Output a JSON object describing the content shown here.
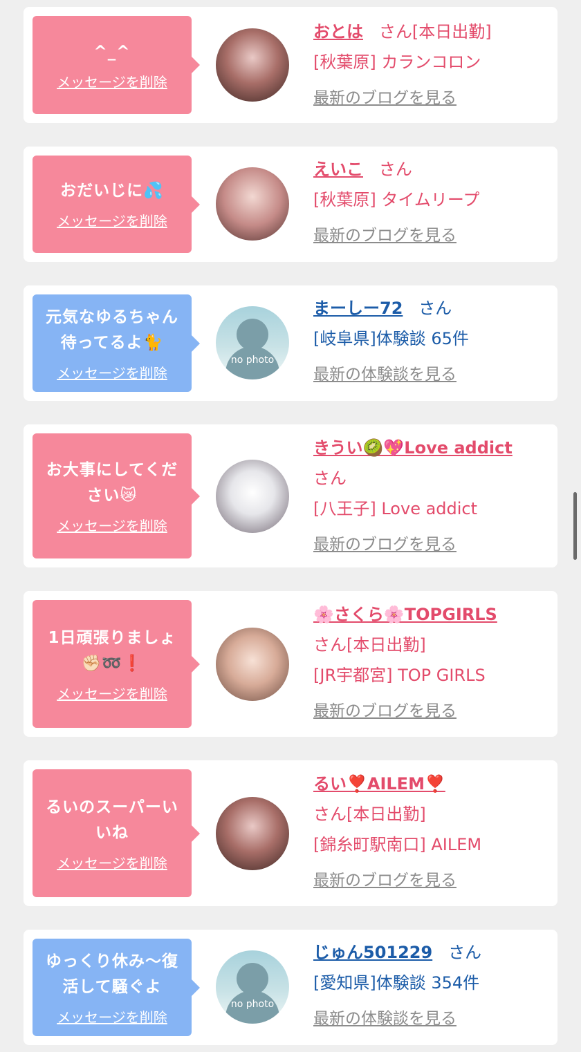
{
  "delete_label": "メッセージを削除",
  "cards": [
    {
      "type": "girl",
      "bubble_color": "pink",
      "message": "^_^",
      "name": "おとは",
      "suffix": "さん[本日出勤]",
      "area": "[秋葉原] カランコロン",
      "link": "最新のブログを見る",
      "avatar": "photo"
    },
    {
      "type": "girl",
      "bubble_color": "pink",
      "message": "おだいじに💦",
      "name": "えいこ",
      "suffix": "さん",
      "area": "[秋葉原] タイムリープ",
      "link": "最新のブログを見る",
      "avatar": "photo"
    },
    {
      "type": "user",
      "bubble_color": "blue",
      "message": "元気なゆるちゃん待ってるよ🐈",
      "name": "まーしー72",
      "suffix": "さん",
      "area": "[岐阜県]体験談 65件",
      "link": "最新の体験談を見る",
      "avatar": "no photo"
    },
    {
      "type": "girl",
      "bubble_color": "pink",
      "message": "お大事にしてください😿",
      "name": "きうい🥝💖Love addict",
      "suffix": "さん",
      "area": "[八王子] Love addict",
      "link": "最新のブログを見る",
      "avatar": "photo"
    },
    {
      "type": "girl",
      "bubble_color": "pink",
      "message": "1日頑張りましょ✊🏻➿❗",
      "name": "🌸さくら🌸TOPGIRLS",
      "suffix": "さん[本日出勤]",
      "area": "[JR宇都宮] TOP GIRLS",
      "link": "最新のブログを見る",
      "avatar": "photo"
    },
    {
      "type": "girl",
      "bubble_color": "pink",
      "message": "るいのスーパーいいね",
      "name": "るい❣️AILEM❣️",
      "suffix": "さん[本日出勤]",
      "area": "[錦糸町駅南口] AILEM",
      "link": "最新のブログを見る",
      "avatar": "photo"
    },
    {
      "type": "user",
      "bubble_color": "blue",
      "message": "ゆっくり休み～復活して騒ぐよ",
      "name": "じゅん501229",
      "suffix": "さん",
      "area": "[愛知県]体験談 354件",
      "link": "最新の体験談を見る",
      "avatar": "no photo"
    }
  ],
  "colors": {
    "pink_bubble": "#f6889b",
    "blue_bubble": "#86b4f4",
    "girl_name": "#e34b6b",
    "user_name": "#1c5ca8",
    "link_gray": "#8c8c8c",
    "background": "#efefef"
  }
}
